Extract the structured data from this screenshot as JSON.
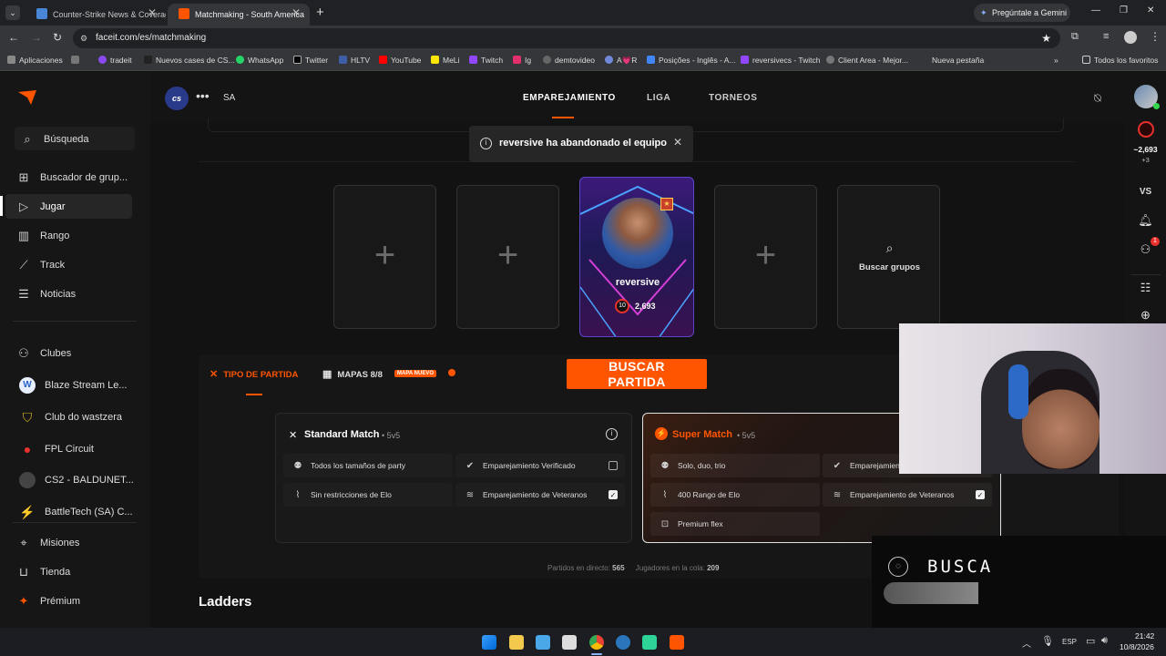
{
  "browser": {
    "tabs": [
      {
        "title": "Counter-Strike News & Coverag",
        "active": false
      },
      {
        "title": "Matchmaking - South America",
        "active": true
      }
    ],
    "new_tab": "+",
    "url": "faceit.com/es/matchmaking",
    "gemini_label": "Pregúntale a Gemini",
    "bookmarks": [
      "Aplicaciones",
      "tradeit",
      "Nuevos cases de CS...",
      "WhatsApp",
      "Twitter",
      "HLTV",
      "YouTube",
      "MeLi",
      "Twitch",
      "Ig",
      "demtovideo",
      "A💗R",
      "Posições - Inglês - A...",
      "reversivecs - Twitch",
      "Client Area - Mejor...",
      "Nueva pestaña"
    ],
    "all_bookmarks": "Todos los favoritos"
  },
  "sidebar": {
    "search": "Búsqueda",
    "items": [
      "Buscador de grup...",
      "Jugar",
      "Rango",
      "Track",
      "Noticias"
    ],
    "clubs_label": "Clubes",
    "clubs": [
      "Blaze Stream Le...",
      "Club do wastzera",
      "FPL Circuit",
      "CS2 - BALDUNET...",
      "BattleTech (SA) C..."
    ],
    "bottom": [
      "Misiones",
      "Tienda",
      "Prémium"
    ]
  },
  "topnav": {
    "game_logo": "cs",
    "region": "SA",
    "links": [
      "EMPAREJAMIENTO",
      "LIGA",
      "TORNEOS"
    ]
  },
  "toast": {
    "text": "reversive ha abandonado el equipo"
  },
  "party": {
    "player_name": "reversive",
    "level": "10",
    "elo": "2,693",
    "find_groups": "Buscar grupos"
  },
  "options": {
    "match_type": "TIPO DE PARTIDA",
    "maps": "MAPAS 8/8",
    "maps_badge": "MAPA NUEVO",
    "find_match": "BUSCAR PARTIDA"
  },
  "standard": {
    "title": "Standard Match",
    "mode": "• 5v5",
    "f1": "Todos los tamaños de party",
    "f2": "Emparejamiento Verificado",
    "f3": "Sin restricciones de Elo",
    "f4": "Emparejamiento de Veteranos"
  },
  "super": {
    "title": "Super Match",
    "mode": "• 5v5",
    "f1": "Solo, duo, trio",
    "f2": "Emparejamiento",
    "f3": "400 Rango de Elo",
    "f4": "Emparejamiento de Veteranos",
    "f5": "Premium flex"
  },
  "stats": {
    "live_label": "Partidos en directo:",
    "live_value": "565",
    "queue_label": "Jugadores en la cola:",
    "queue_value": "209"
  },
  "ladders": "Ladders",
  "rightbar": {
    "elo": "~2,693",
    "elo_delta": "+3",
    "vs": "VS",
    "notif": "1"
  },
  "overlay": {
    "text": "BUSCA"
  },
  "taskbar": {
    "lang": "ESP",
    "time": "21:42",
    "date": "10/8/2026"
  }
}
